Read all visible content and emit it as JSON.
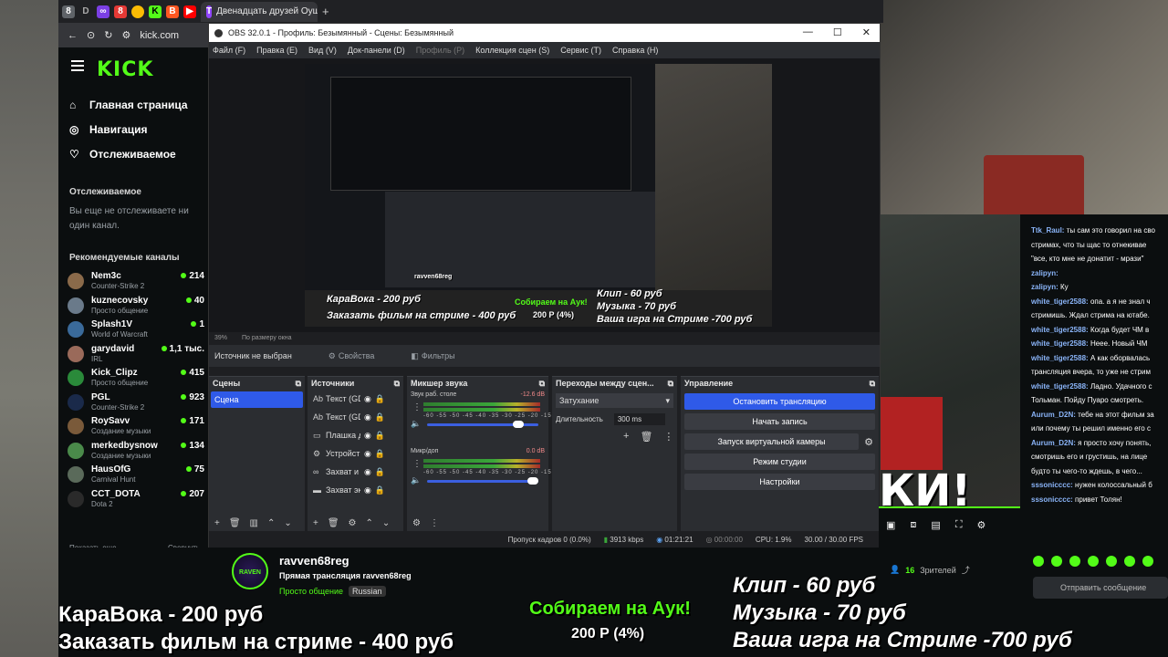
{
  "browser": {
    "active_tab_title": "Двенадцать друзей Оуш",
    "url": "kick.com"
  },
  "kick": {
    "logo": "KICK",
    "nav": [
      {
        "label": "Главная страница",
        "icon": "home-icon"
      },
      {
        "label": "Навигация",
        "icon": "compass-icon"
      },
      {
        "label": "Отслеживаемое",
        "icon": "heart-icon"
      }
    ],
    "following_title": "Отслеживаемое",
    "following_empty": "Вы еще не отслеживаете ни один канал.",
    "recommended_title": "Рекомендуемые каналы",
    "channels": [
      {
        "name": "Nem3c",
        "category": "Counter-Strike 2",
        "viewers": "214",
        "color": "#8a6a4a"
      },
      {
        "name": "kuznecovsky",
        "category": "Просто общение",
        "viewers": "40",
        "color": "#6a7a8a"
      },
      {
        "name": "Splash1V",
        "category": "World of Warcraft",
        "viewers": "1",
        "color": "#3a6a9a"
      },
      {
        "name": "garydavid",
        "category": "IRL",
        "viewers": "1,1 тыс.",
        "color": "#9a6a5a"
      },
      {
        "name": "Kick_Clipz",
        "category": "Просто общение",
        "viewers": "415",
        "color": "#2a8a3a"
      },
      {
        "name": "PGL",
        "category": "Counter-Strike 2",
        "viewers": "923",
        "color": "#1a2a4a"
      },
      {
        "name": "RoySavv",
        "category": "Создание музыки",
        "viewers": "171",
        "color": "#7a5a3a"
      },
      {
        "name": "merkedbysnow",
        "category": "Создание музыки",
        "viewers": "134",
        "color": "#4a8a4a"
      },
      {
        "name": "HausOfG",
        "category": "Carnival Hunt",
        "viewers": "75",
        "color": "#5a6a5a"
      },
      {
        "name": "CCT_DOTA",
        "category": "Dota 2",
        "viewers": "207",
        "color": "#2a2a2a"
      }
    ],
    "show_more": "Показать еще",
    "collapse": "Свернуть"
  },
  "obs": {
    "title": "OBS 32.0.1 - Профиль: Безымянный - Сцены: Безымянный",
    "menu": [
      "Файл (F)",
      "Правка (E)",
      "Вид (V)",
      "Док-панели (D)",
      "Профиль (P)",
      "Коллекция сцен (S)",
      "Сервис (T)",
      "Справка (H)"
    ],
    "zoom": "39%",
    "zoom_mode": "По размеру окна",
    "source_none": "Источник не выбран",
    "properties": "Свойства",
    "filters": "Фильтры",
    "docks": {
      "scenes": "Сцены",
      "sources": "Источники",
      "mixer": "Микшер звука",
      "transitions": "Переходы между сцен...",
      "controls": "Управление"
    },
    "scenes": [
      "Сцена"
    ],
    "sources": [
      {
        "name": "Текст (GD",
        "icon": "text-icon"
      },
      {
        "name": "Текст (GD",
        "icon": "text-icon"
      },
      {
        "name": "Плашка д",
        "icon": "image-icon"
      },
      {
        "name": "Устройст",
        "icon": "device-icon"
      },
      {
        "name": "Захват и",
        "icon": "capture-icon"
      },
      {
        "name": "Захват эк",
        "icon": "screen-icon"
      }
    ],
    "mixer": [
      {
        "name": "Звук раб. столе",
        "db": "-12.6 dB",
        "level": 0.85
      },
      {
        "name": "Микр/доп",
        "db": "0.0 dB",
        "level": 1.0
      }
    ],
    "meter_scale": "-60 -55 -50 -45 -40 -35 -30 -25 -20 -15 -10 -5 0",
    "transition": "Затухание",
    "duration_label": "Длительность",
    "duration_value": "300 ms",
    "controls": [
      "Остановить трансляцию",
      "Начать запись",
      "Запуск виртуальной камеры",
      "Режим студии",
      "Настройки"
    ],
    "status": {
      "dropped": "Пропуск кадров 0 (0.0%)",
      "kbps": "3913 kbps",
      "live_time": "01:21:21",
      "rec_time": "00:00:00",
      "cpu": "CPU: 1.9%",
      "fps": "30.00 / 30.00 FPS"
    },
    "preview_overlays": {
      "karaoke": "КараВока - 200 руб",
      "film": "Заказать фильм на стриме - 400 руб",
      "auction": "Собираем на Аук!",
      "auction_sum": "200 Р (4%)",
      "clip": "Клип - 60 руб",
      "music": "Музыка - 70 руб",
      "game": "Ваша игра на Стриме -700 руб",
      "mini_name": "ravven68reg"
    }
  },
  "stream": {
    "avatar_text": "RAVEN",
    "channel": "ravven68reg",
    "title": "Прямая трансляция ravven68reg",
    "category": "Просто общение",
    "language": "Russian",
    "overlay_karaoke": "КараВока - 200 руб",
    "overlay_film": "Заказать фильм на стриме - 400 руб",
    "overlay_auction": "Собираем на Аук!",
    "overlay_auction_sum": "200 Р (4%)",
    "overlay_clip": "Клип - 60 руб",
    "overlay_music": "Музыка - 70 руб",
    "overlay_game": "Ваша игра на Стриме -700 руб",
    "cam_text": "КИ!"
  },
  "chat": {
    "messages": [
      {
        "user": "Ttk_Raul:",
        "text": "ты сам это говорил на сво"
      },
      {
        "user": "",
        "text": "стримах, что ты щас то отнекивае"
      },
      {
        "user": "",
        "text": "\"все, кто мне не донатит - мрази\""
      },
      {
        "user": "zalipyn:",
        "text": ""
      },
      {
        "user": "zalipyn:",
        "text": "Ку"
      },
      {
        "user": "white_tiger2588:",
        "text": "опа. а я не знал ч"
      },
      {
        "user": "",
        "text": "стримишь. Ждал стрима на ютабе."
      },
      {
        "user": "white_tiger2588:",
        "text": "Когда будет ЧМ в"
      },
      {
        "user": "white_tiger2588:",
        "text": "Нееe. Новый ЧМ"
      },
      {
        "user": "white_tiger2588:",
        "text": "А как оборвалась"
      },
      {
        "user": "",
        "text": "трансляция вчера, то уже не стрим"
      },
      {
        "user": "white_tiger2588:",
        "text": "Ладно. Удачного с"
      },
      {
        "user": "",
        "text": "Тольман. Пойду Пуаро смотреть."
      },
      {
        "user": "Aurum_D2N:",
        "text": "тебе на этот фильм за"
      },
      {
        "user": "",
        "text": "или почему ты решил именно его с"
      },
      {
        "user": "Aurum_D2N:",
        "text": "я просто хочу понять,"
      },
      {
        "user": "",
        "text": "смотришь его и грустишь, на лице"
      },
      {
        "user": "",
        "text": "будто ты чего-то ждешь, в чего..."
      },
      {
        "user": "sssonicccc:",
        "text": "нужен колоссальный б"
      },
      {
        "user": "sssonicccc:",
        "text": "привет Толян!"
      }
    ],
    "viewers": "16",
    "viewers_label": "Зрителей",
    "send_placeholder": "Отправить сообщение"
  },
  "colors": {
    "kick_green": "#53fc18",
    "obs_blue": "#2f5ae8"
  }
}
